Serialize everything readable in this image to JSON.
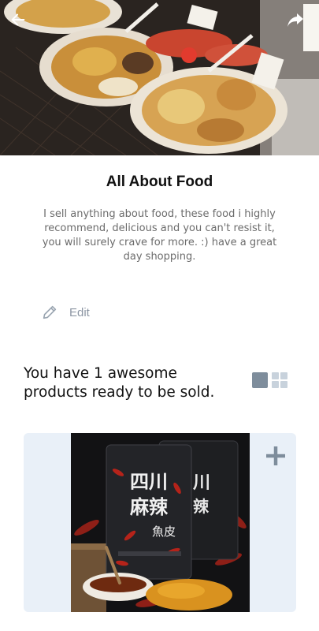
{
  "nav": {
    "back_icon": "arrow-left-icon",
    "share_icon": "share-forward-icon"
  },
  "shop": {
    "title": "All About Food",
    "description": "I sell anything about food, these food i highly recommend, delicious and you can't resist it, you will surely crave for more. :) have a great day shopping."
  },
  "edit": {
    "label": "Edit",
    "icon": "pencil-icon"
  },
  "products": {
    "heading": "You have 1 awesome products ready to be sold.",
    "count": 1,
    "view_single_icon": "single-view-icon",
    "view_grid_icon": "grid-view-icon",
    "items": [
      {
        "package_text": "四川麻辣",
        "package_text_2": "魚皮",
        "add_icon": "plus-icon"
      }
    ]
  },
  "colors": {
    "card_bg": "#e9f0f8",
    "icon_gray": "#7e8d9c",
    "desc_text": "#6b6b6b"
  }
}
